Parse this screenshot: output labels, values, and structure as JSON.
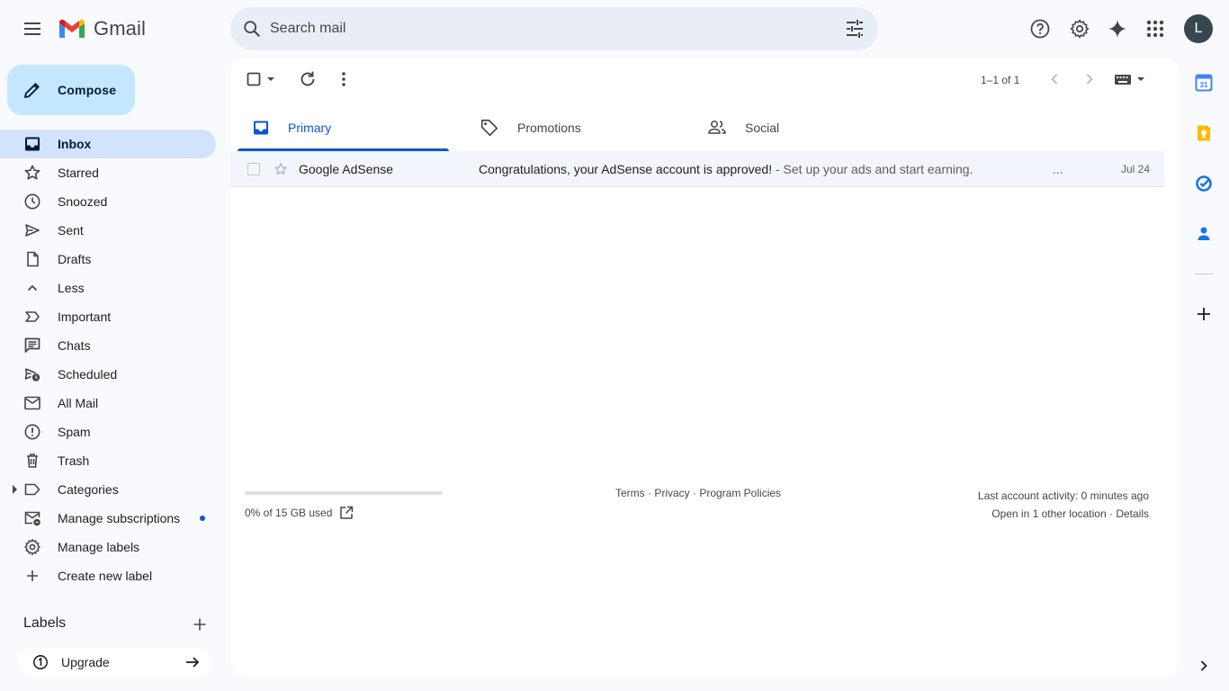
{
  "app": {
    "name": "Gmail"
  },
  "search": {
    "placeholder": "Search mail"
  },
  "account": {
    "initial": "L"
  },
  "compose": {
    "label": "Compose"
  },
  "sidebar": {
    "items": [
      {
        "label": "Inbox",
        "icon": "inbox-icon",
        "active": true
      },
      {
        "label": "Starred",
        "icon": "star-icon"
      },
      {
        "label": "Snoozed",
        "icon": "clock-icon"
      },
      {
        "label": "Sent",
        "icon": "send-icon"
      },
      {
        "label": "Drafts",
        "icon": "draft-icon"
      },
      {
        "label": "Less",
        "icon": "chevron-up-icon"
      },
      {
        "label": "Important",
        "icon": "important-icon"
      },
      {
        "label": "Chats",
        "icon": "chat-icon"
      },
      {
        "label": "Scheduled",
        "icon": "scheduled-send-icon"
      },
      {
        "label": "All Mail",
        "icon": "all-mail-icon"
      },
      {
        "label": "Spam",
        "icon": "spam-icon"
      },
      {
        "label": "Trash",
        "icon": "trash-icon"
      },
      {
        "label": "Categories",
        "icon": "label-icon"
      },
      {
        "label": "Manage subscriptions",
        "icon": "manage-subscriptions-icon"
      },
      {
        "label": "Manage labels",
        "icon": "gear-icon"
      },
      {
        "label": "Create new label",
        "icon": "plus-icon"
      }
    ],
    "labels_heading": "Labels",
    "upgrade_label": "Upgrade"
  },
  "toolbar": {
    "pager": "1–1 of 1"
  },
  "tabs": [
    {
      "label": "Primary",
      "active": true
    },
    {
      "label": "Promotions"
    },
    {
      "label": "Social"
    }
  ],
  "emails": [
    {
      "sender": "Google AdSense",
      "subject": "Congratulations, your AdSense account is approved!",
      "snippet": " - Set up your ads and start earning.",
      "ellipsis": "...",
      "date": "Jul 24"
    }
  ],
  "footer": {
    "storage": "0% of 15 GB used",
    "storage_used_fraction": 0,
    "links": "Terms · Privacy · Program Policies",
    "activity": "Last account activity: 0 minutes ago",
    "other_location": "Open in 1 other location · Details"
  },
  "colors": {
    "accent": "#0b57d0",
    "compose_bg": "#c2e7ff",
    "active_nav_bg": "#d3e3fd",
    "page_bg": "#f8fafd"
  }
}
